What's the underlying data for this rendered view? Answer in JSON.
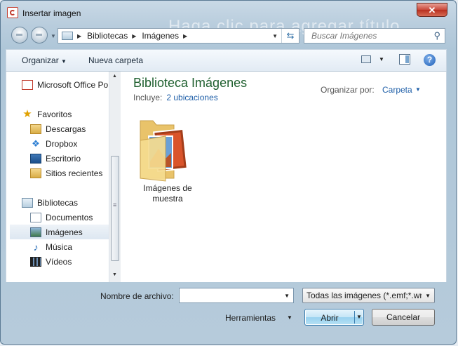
{
  "window": {
    "title": "Insertar imagen",
    "background_title": "Haga clic para agregar título",
    "close_glyph": "✕"
  },
  "address_bar": {
    "segments": [
      "Bibliotecas",
      "Imágenes"
    ]
  },
  "search": {
    "placeholder": "Buscar Imágenes"
  },
  "toolbar": {
    "organize": "Organizar",
    "new_folder": "Nueva carpeta"
  },
  "nav_pane": {
    "top_item": "Microsoft Office Po",
    "favorites": {
      "header": "Favoritos",
      "items": [
        "Descargas",
        "Dropbox",
        "Escritorio",
        "Sitios recientes"
      ]
    },
    "libraries": {
      "header": "Bibliotecas",
      "items": [
        "Documentos",
        "Imágenes",
        "Música",
        "Vídeos"
      ],
      "selected": "Imágenes"
    }
  },
  "library": {
    "title": "Biblioteca Imágenes",
    "includes_label": "Incluye:",
    "includes_link": "2 ubicaciones",
    "arrange_label": "Organizar por:",
    "arrange_value": "Carpeta"
  },
  "items": [
    {
      "label_line1": "Imágenes de",
      "label_line2": "muestra",
      "icon": "folder-with-pictures-icon"
    }
  ],
  "bottom": {
    "filename_label": "Nombre de archivo:",
    "filename_value": "",
    "filetype_value": "Todas las imágenes (*.emf;*.wr",
    "tools": "Herramientas",
    "open": "Abrir",
    "cancel": "Cancelar"
  },
  "colors": {
    "library_title": "#1e5f2e",
    "link": "#1f5fa8",
    "close": "#c9483a"
  }
}
